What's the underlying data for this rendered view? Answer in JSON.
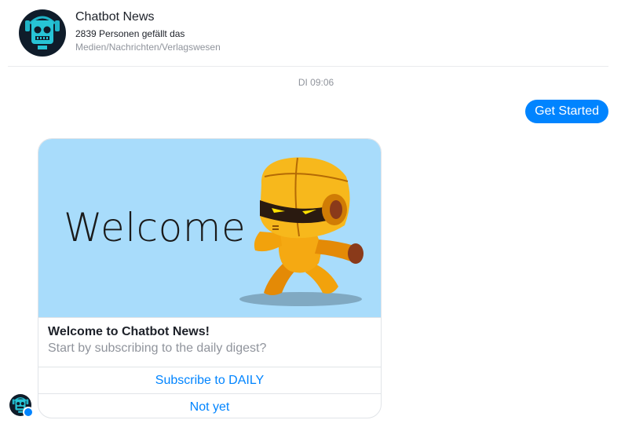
{
  "header": {
    "page_name": "Chatbot News",
    "likes": "2839 Personen gefällt das",
    "category": "Medien/Nachrichten/Verlagswesen",
    "avatar_icon": "robot-face-icon"
  },
  "conversation": {
    "timestamp": "DI 09:06",
    "user_message": "Get Started"
  },
  "card": {
    "image_text": "Welcome",
    "title": "Welcome to Chatbot News!",
    "subtitle": "Start by subscribing to the daily digest?",
    "buttons": [
      "Subscribe to DAILY",
      "Not yet"
    ]
  },
  "colors": {
    "accent": "#0084ff",
    "card_image_bg": "#a8dcfb",
    "robot_gold": "#f2a20c"
  }
}
